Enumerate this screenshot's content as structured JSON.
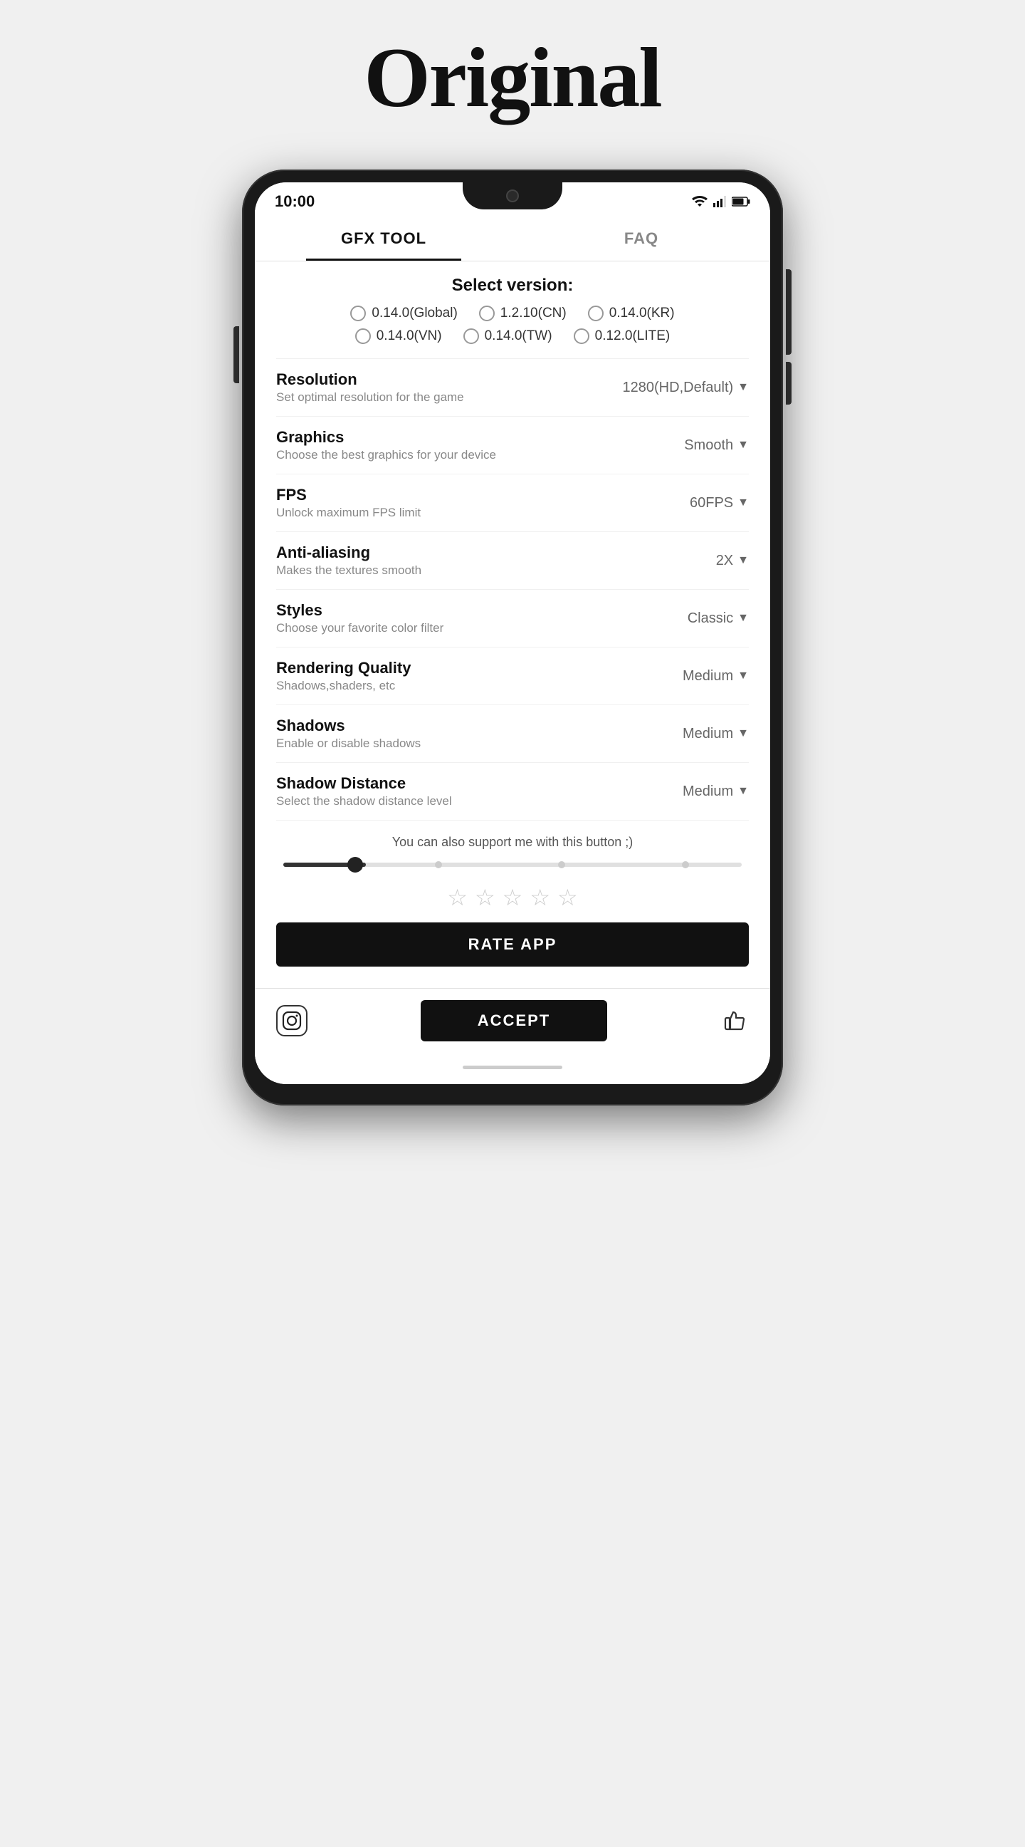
{
  "page": {
    "title": "Original"
  },
  "tabs": [
    {
      "id": "gfx-tool",
      "label": "GFX TOOL",
      "active": true
    },
    {
      "id": "faq",
      "label": "FAQ",
      "active": false
    }
  ],
  "version_section": {
    "title": "Select version:",
    "options": [
      {
        "id": "global",
        "label": "0.14.0(Global)",
        "selected": false
      },
      {
        "id": "cn",
        "label": "1.2.10(CN)",
        "selected": false
      },
      {
        "id": "kr",
        "label": "0.14.0(KR)",
        "selected": false
      },
      {
        "id": "vn",
        "label": "0.14.0(VN)",
        "selected": false
      },
      {
        "id": "tw",
        "label": "0.14.0(TW)",
        "selected": false
      },
      {
        "id": "lite",
        "label": "0.12.0(LITE)",
        "selected": false
      }
    ]
  },
  "settings": [
    {
      "id": "resolution",
      "name": "Resolution",
      "description": "Set optimal resolution for the game",
      "value": "1280(HD,Default)"
    },
    {
      "id": "graphics",
      "name": "Graphics",
      "description": "Choose the best graphics for your device",
      "value": "Smooth"
    },
    {
      "id": "fps",
      "name": "FPS",
      "description": "Unlock maximum FPS limit",
      "value": "60FPS"
    },
    {
      "id": "anti-aliasing",
      "name": "Anti-aliasing",
      "description": "Makes the textures smooth",
      "value": "2X"
    },
    {
      "id": "styles",
      "name": "Styles",
      "description": "Choose your favorite color filter",
      "value": "Classic"
    },
    {
      "id": "rendering-quality",
      "name": "Rendering Quality",
      "description": "Shadows,shaders, etc",
      "value": "Medium"
    },
    {
      "id": "shadows",
      "name": "Shadows",
      "description": "Enable or disable shadows",
      "value": "Medium"
    },
    {
      "id": "shadow-distance",
      "name": "Shadow Distance",
      "description": "Select the shadow distance level",
      "value": "Medium"
    }
  ],
  "support": {
    "text": "You can also support me with this button ;)"
  },
  "stars": {
    "count": 5,
    "filled": 0
  },
  "buttons": {
    "rate_app": "RATE APP",
    "accept": "ACCEPT"
  },
  "status_bar": {
    "time": "10:00"
  }
}
